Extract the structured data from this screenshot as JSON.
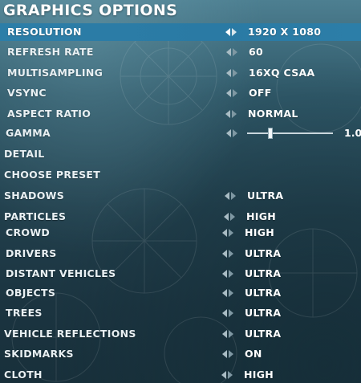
{
  "title": "GRAPHICS OPTIONS",
  "colors": {
    "selected_row": "#2a7aa4",
    "background": "#213f4c",
    "text": "#ffffff"
  },
  "options": [
    {
      "label": "RESOLUTION",
      "value": "1920 X 1080",
      "selected": true
    },
    {
      "label": "REFRESH RATE",
      "value": "60"
    },
    {
      "label": "MULTISAMPLING",
      "value": "16XQ CSAA"
    },
    {
      "label": "VSYNC",
      "value": "OFF"
    },
    {
      "label": "ASPECT RATIO",
      "value": "NORMAL"
    },
    {
      "label": "GAMMA",
      "value": "1.0",
      "slider_fraction": 0.27
    },
    {
      "label": "DETAIL"
    },
    {
      "label": "CHOOSE PRESET"
    },
    {
      "label": "SHADOWS",
      "value": "ULTRA"
    },
    {
      "label": "PARTICLES",
      "value": "HIGH"
    },
    {
      "label": "CROWD",
      "value": "HIGH"
    },
    {
      "label": "DRIVERS",
      "value": "ULTRA"
    },
    {
      "label": "DISTANT VEHICLES",
      "value": "ULTRA"
    },
    {
      "label": "OBJECTS",
      "value": "ULTRA"
    },
    {
      "label": "TREES",
      "value": "ULTRA"
    },
    {
      "label": "VEHICLE REFLECTIONS",
      "value": "ULTRA"
    },
    {
      "label": "SKIDMARKS",
      "value": "ON"
    },
    {
      "label": "CLOTH",
      "value": "HIGH"
    }
  ]
}
